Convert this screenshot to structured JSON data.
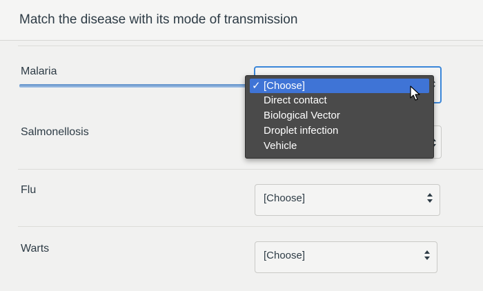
{
  "question": {
    "title": "Match the disease with its mode of transmission"
  },
  "rows": [
    {
      "label": "Malaria",
      "selected": "[Choose]"
    },
    {
      "label": "Salmonellosis",
      "selected": "[Choose]"
    },
    {
      "label": "Flu",
      "selected": "[Choose]"
    },
    {
      "label": "Warts",
      "selected": "[Choose]"
    }
  ],
  "dropdown": {
    "open_for_row": "Malaria",
    "options": [
      "[Choose]",
      "Direct contact",
      "Biological Vector",
      "Droplet infection",
      "Vehicle"
    ],
    "selected_index": 0,
    "checkmark": "✓"
  },
  "colors": {
    "focus_border": "#3a86d9",
    "menu_background": "#4a4a4a",
    "menu_highlight": "#3f74d6"
  }
}
